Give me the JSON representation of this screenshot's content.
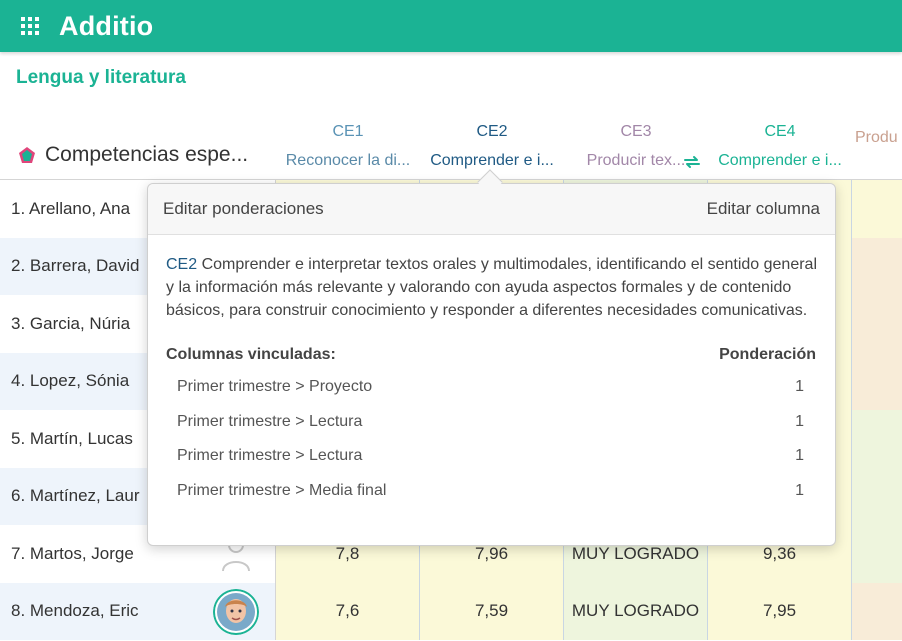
{
  "app": {
    "brand": "Additio"
  },
  "course": {
    "title": "Lengua y literatura"
  },
  "competencies_header": {
    "label": "Competencias espe..."
  },
  "columns": [
    {
      "code": "CE1",
      "desc": "Reconocer la di...",
      "code_color": "#5a93b5",
      "desc_color": "#5a8aa8"
    },
    {
      "code": "CE2",
      "desc": "Comprender e i...",
      "code_color": "#1f5a84",
      "desc_color": "#1f5a84"
    },
    {
      "code": "CE3",
      "desc": "Producir tex...",
      "code_color": "#a287a8",
      "desc_color": "#a287a8"
    },
    {
      "code": "CE4",
      "desc": "Comprender e i...",
      "code_color": "#1bb394",
      "desc_color": "#1bb394"
    },
    {
      "code": "",
      "desc": "Produ",
      "code_color": "#c09080",
      "desc_color": "#c9a08f"
    }
  ],
  "students": [
    {
      "name": "1. Arellano, Ana",
      "values": [
        "",
        "",
        "",
        ""
      ]
    },
    {
      "name": "2. Barrera, David",
      "values": [
        "",
        "",
        "",
        ""
      ]
    },
    {
      "name": "3. Garcia, Núria",
      "values": [
        "",
        "",
        "",
        ""
      ]
    },
    {
      "name": "4. Lopez, Sónia",
      "values": [
        "",
        "",
        "",
        ""
      ]
    },
    {
      "name": "5. Martín, Lucas",
      "values": [
        "",
        "",
        "",
        ""
      ]
    },
    {
      "name": "6. Martínez, Laur",
      "values": [
        "",
        "",
        "",
        ""
      ]
    },
    {
      "name": "7. Martos, Jorge",
      "values": [
        "7,8",
        "7,96",
        "MUY LOGRADO",
        "9,36"
      ]
    },
    {
      "name": "8. Mendoza, Eric",
      "values": [
        "7,6",
        "7,59",
        "MUY LOGRADO",
        "7,95"
      ]
    }
  ],
  "popover": {
    "edit_weights": "Editar ponderaciones",
    "edit_column": "Editar columna",
    "code": "CE2",
    "description": " Comprender e interpretar textos orales y multimodales, identificando el sentido general y la información más relevante y valorando con ayuda aspectos formales y de contenido básicos, para construir conocimiento y responder a diferentes necesidades comunicativas.",
    "linked_label": "Columnas vinculadas:",
    "weight_label": "Ponderación",
    "linked": [
      {
        "name": "Primer trimestre > Proyecto",
        "weight": "1"
      },
      {
        "name": "Primer trimestre > Lectura",
        "weight": "1"
      },
      {
        "name": "Primer trimestre > Lectura",
        "weight": "1"
      },
      {
        "name": "Primer trimestre > Media final",
        "weight": "1"
      }
    ]
  },
  "colors": {
    "brand": "#1bb394",
    "row_alt": "#eef4fb",
    "cell_yellow": "#fbf9d8",
    "cell_green": "#eef5dd",
    "cell_peach": "#f8ecd8"
  }
}
